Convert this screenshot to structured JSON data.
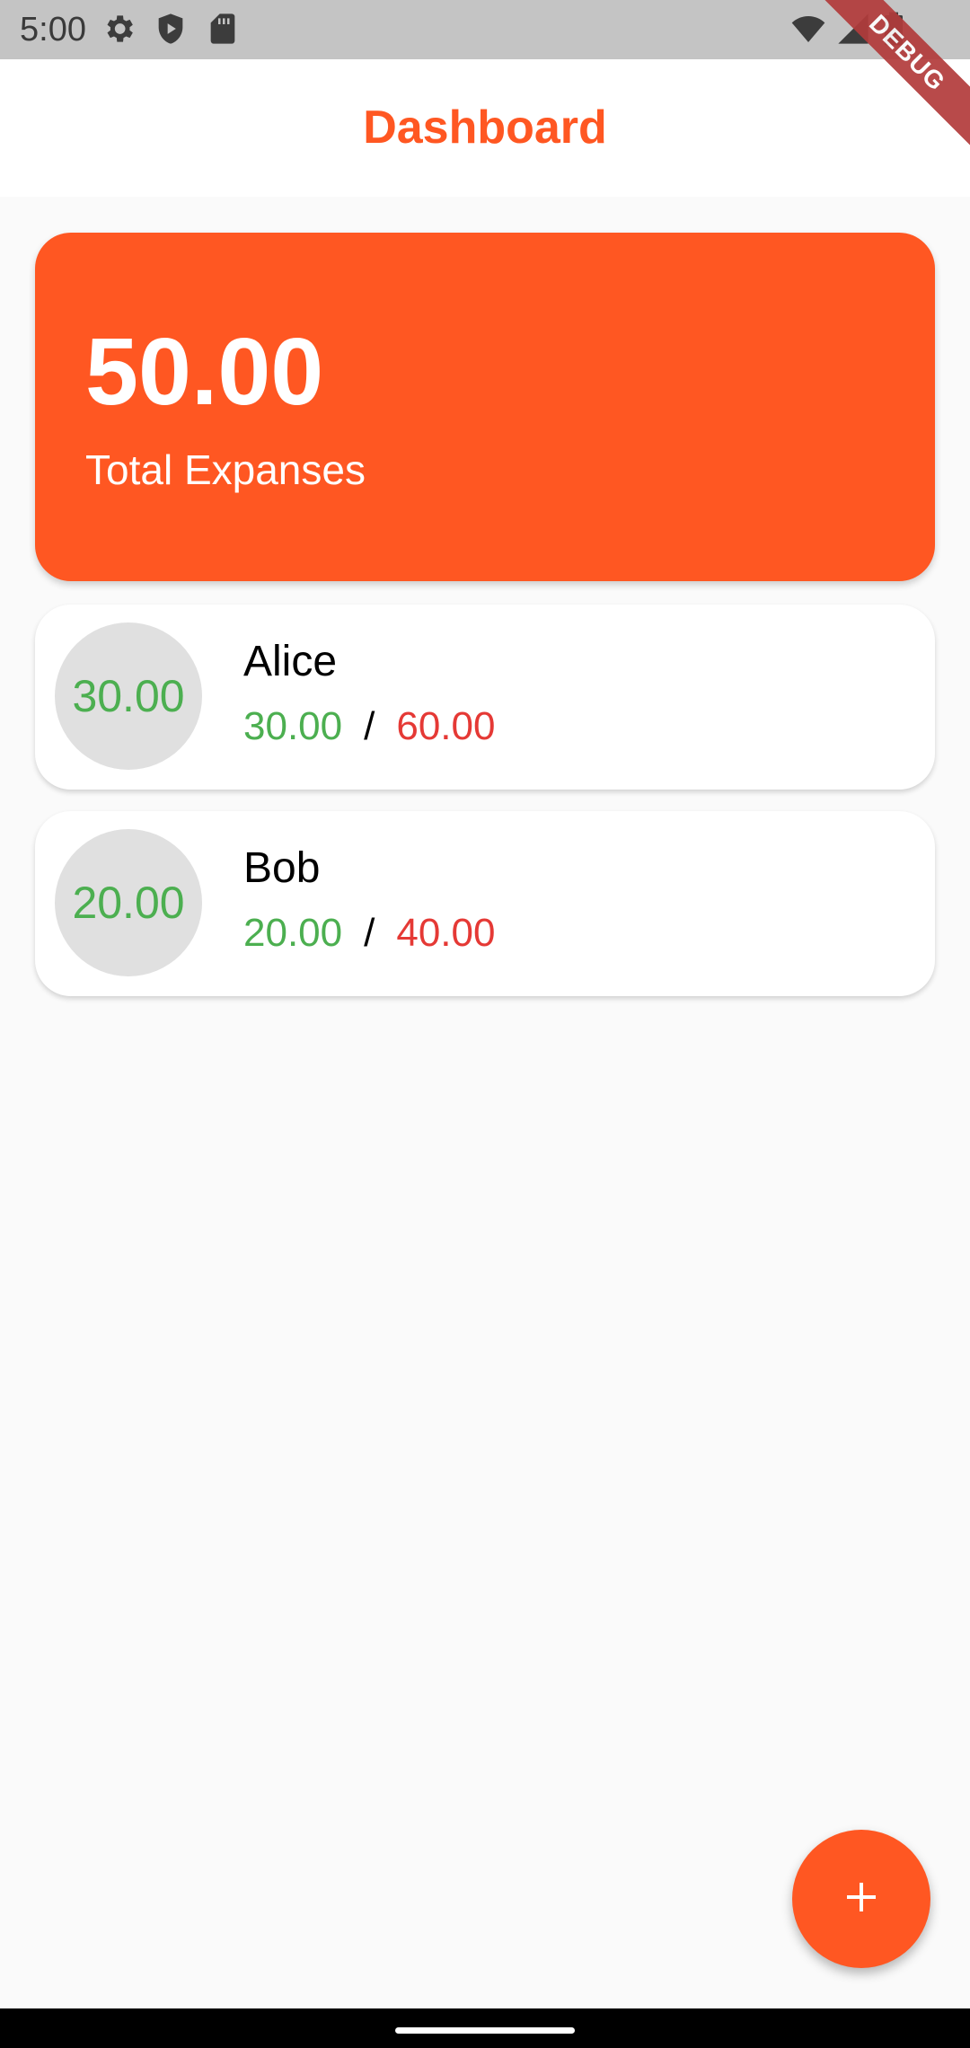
{
  "status_bar": {
    "time": "5:00",
    "icons": [
      "gear-icon",
      "play-protect-icon",
      "sd-card-icon",
      "wifi-icon",
      "signal-icon",
      "battery-icon"
    ]
  },
  "debug_banner": "DEBUG",
  "app_bar": {
    "title": "Dashboard"
  },
  "total_card": {
    "amount": "50.00",
    "label": "Total Expanses"
  },
  "people": [
    {
      "avatar_value": "30.00",
      "name": "Alice",
      "paid": "30.00",
      "separator": "/",
      "owed": "60.00"
    },
    {
      "avatar_value": "20.00",
      "name": "Bob",
      "paid": "20.00",
      "separator": "/",
      "owed": "40.00"
    }
  ],
  "fab": {
    "icon": "plus-icon"
  },
  "colors": {
    "accent": "#ff5722",
    "paid": "#4caf50",
    "owed": "#e53935",
    "avatar_bg": "#e0e0e0",
    "background": "#fafafa"
  }
}
